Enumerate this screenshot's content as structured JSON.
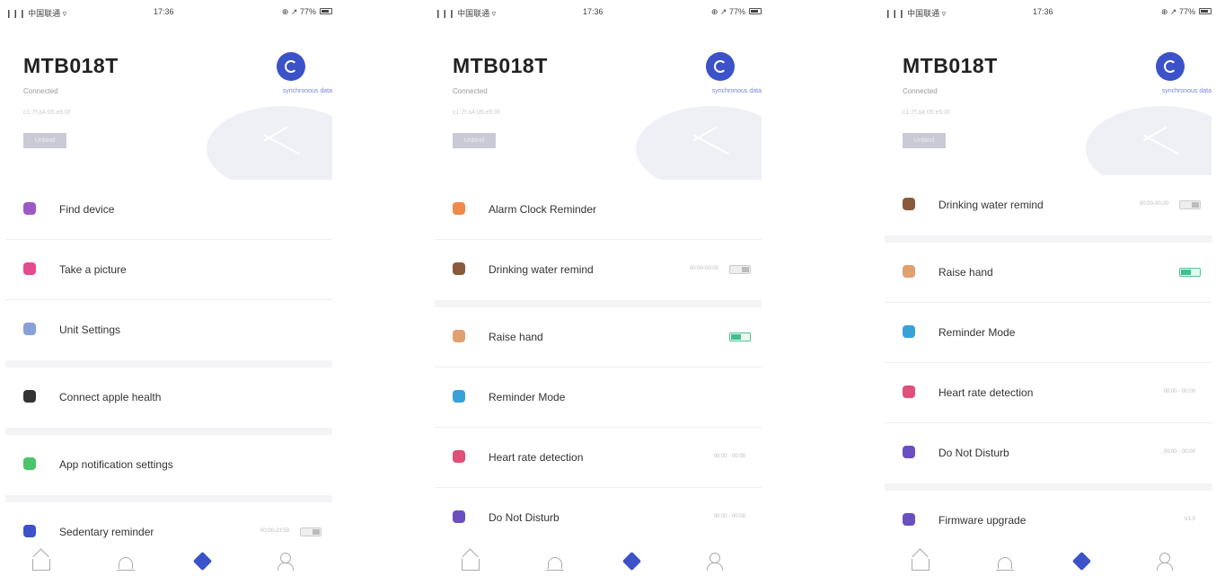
{
  "statusbar": {
    "carrier": "❙❙❙ 中国联通 ▿",
    "time": "17:36",
    "battery": "⊕ ↗ 77%"
  },
  "device": {
    "name": "MTB018T",
    "status": "Connected",
    "mac": "c1:7f:a4:05:e5:0f",
    "unbind_label": "Unbind",
    "sync_label": "synchronous data"
  },
  "colors": {
    "accent": "#3b52c9",
    "toggle_on": "#3fbf8e"
  },
  "screens": [
    {
      "menu": [
        {
          "icon": "find-device-icon",
          "color": "#9b59c6",
          "label": "Find device",
          "value": "",
          "toggle": "",
          "gap_after": false
        },
        {
          "icon": "camera-icon",
          "color": "#e64a8f",
          "label": "Take a picture",
          "value": "",
          "toggle": "",
          "gap_after": false
        },
        {
          "icon": "unit-settings-icon",
          "color": "#8aa0d8",
          "label": "Unit Settings",
          "value": "",
          "toggle": "",
          "gap_after": true
        },
        {
          "icon": "apple-icon",
          "color": "#333333",
          "label": "Connect apple health",
          "value": "",
          "toggle": "",
          "gap_after": true
        },
        {
          "icon": "chat-bubble-icon",
          "color": "#4cc46a",
          "label": "App notification settings",
          "value": "",
          "toggle": "",
          "gap_after": true
        },
        {
          "icon": "sedentary-icon",
          "color": "#3b52c9",
          "label": "Sedentary reminder",
          "value": "00:00-23:59",
          "toggle": "off",
          "gap_after": false
        }
      ]
    },
    {
      "menu": [
        {
          "icon": "alarm-clock-icon",
          "color": "#f08a4b",
          "label": "Alarm Clock Reminder",
          "value": "",
          "toggle": "",
          "gap_after": false
        },
        {
          "icon": "water-cup-icon",
          "color": "#8a5a3c",
          "label": "Drinking water remind",
          "value": "00:00-00:00",
          "toggle": "off",
          "gap_after": true
        },
        {
          "icon": "raise-hand-icon",
          "color": "#e0a070",
          "label": "Raise hand",
          "value": "",
          "toggle": "on",
          "gap_after": false
        },
        {
          "icon": "bell-icon",
          "color": "#3aa0d8",
          "label": "Reminder Mode",
          "value": "",
          "toggle": "",
          "gap_after": false
        },
        {
          "icon": "heart-icon",
          "color": "#e0507a",
          "label": "Heart rate detection",
          "value": "00:00 - 00:00",
          "toggle": "",
          "gap_after": false
        },
        {
          "icon": "moon-icon",
          "color": "#6a4fc0",
          "label": "Do Not Disturb",
          "value": "00:00 - 00:00",
          "toggle": "",
          "gap_after": false
        }
      ]
    },
    {
      "menu": [
        {
          "icon": "water-cup-icon",
          "color": "#8a5a3c",
          "label": "Drinking water remind",
          "value": "00:00-00:00",
          "toggle": "off",
          "gap_after": true
        },
        {
          "icon": "raise-hand-icon",
          "color": "#e0a070",
          "label": "Raise hand",
          "value": "",
          "toggle": "on",
          "gap_after": false
        },
        {
          "icon": "bell-icon",
          "color": "#3aa0d8",
          "label": "Reminder Mode",
          "value": "",
          "toggle": "",
          "gap_after": false
        },
        {
          "icon": "heart-icon",
          "color": "#e0507a",
          "label": "Heart rate detection",
          "value": "00:00 - 00:00",
          "toggle": "",
          "gap_after": false
        },
        {
          "icon": "moon-icon",
          "color": "#6a4fc0",
          "label": "Do Not Disturb",
          "value": "00:00 - 00:00",
          "toggle": "",
          "gap_after": true
        },
        {
          "icon": "rocket-icon",
          "color": "#6a4fc0",
          "label": "Firmware upgrade",
          "value": "V1.0",
          "toggle": "",
          "gap_after": false
        }
      ]
    }
  ],
  "tabbar": [
    {
      "icon": "home-icon"
    },
    {
      "icon": "chart-icon"
    },
    {
      "icon": "device-icon"
    },
    {
      "icon": "profile-icon"
    }
  ]
}
